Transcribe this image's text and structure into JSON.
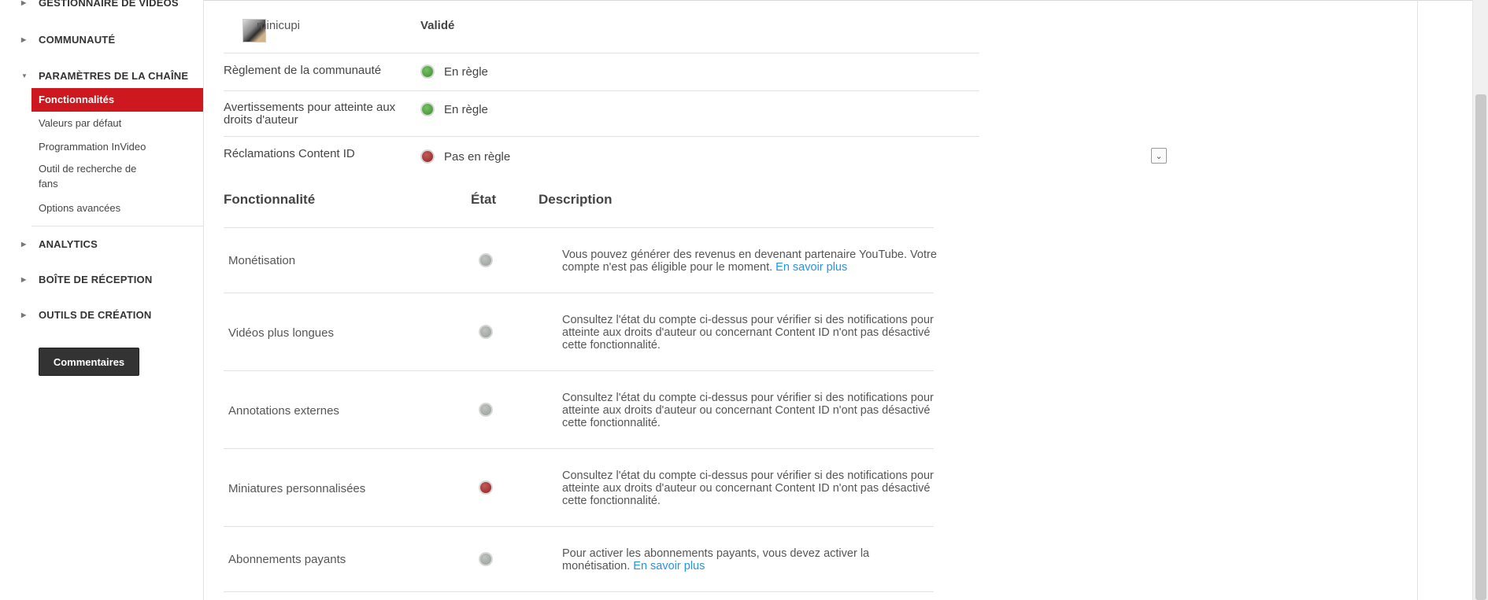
{
  "sidebar": {
    "sections": [
      {
        "label": "GESTIONNAIRE DE VIDÉOS"
      },
      {
        "label": "COMMUNAUTÉ"
      },
      {
        "label": "PARAMÈTRES DE LA CHAÎNE"
      },
      {
        "label": "ANALYTICS"
      },
      {
        "label": "BOÎTE DE RÉCEPTION"
      },
      {
        "label": "OUTILS DE CRÉATION"
      }
    ],
    "sub_items": [
      {
        "label": "Fonctionnalités"
      },
      {
        "label": "Valeurs par défaut"
      },
      {
        "label": "Programmation InVideo"
      },
      {
        "label": "Outil de recherche de fans"
      },
      {
        "label": "Options avancées"
      }
    ],
    "feedback_button": "Commentaires"
  },
  "account": {
    "username": "minicupi",
    "status": "Validé",
    "rows": [
      {
        "label": "Règlement de la communauté",
        "value": "En règle",
        "status": "green"
      },
      {
        "label": "Avertissements pour atteinte aux droits d'auteur",
        "value": "En règle",
        "status": "green"
      },
      {
        "label": "Réclamations Content ID",
        "value": "Pas en règle",
        "status": "red"
      }
    ]
  },
  "features": {
    "headers": {
      "feature": "Fonctionnalité",
      "state": "État",
      "description": "Description"
    },
    "link_label": "En savoir plus",
    "rows": [
      {
        "name": "Monétisation",
        "status": "grey",
        "desc": "Vous pouvez générer des revenus en devenant partenaire YouTube. Votre compte n'est pas éligible pour le moment.",
        "link": "En savoir plus"
      },
      {
        "name": "Vidéos plus longues",
        "status": "grey",
        "desc": "Consultez l'état du compte ci-dessus pour vérifier si des notifications pour atteinte aux droits d'auteur ou concernant Content ID n'ont pas désactivé cette fonctionnalité."
      },
      {
        "name": "Annotations externes",
        "status": "grey",
        "desc": "Consultez l'état du compte ci-dessus pour vérifier si des notifications pour atteinte aux droits d'auteur ou concernant Content ID n'ont pas désactivé cette fonctionnalité."
      },
      {
        "name": "Miniatures personnalisées",
        "status": "red",
        "desc": "Consultez l'état du compte ci-dessus pour vérifier si des notifications pour atteinte aux droits d'auteur ou concernant Content ID n'ont pas désactivé cette fonctionnalité."
      },
      {
        "name": "Abonnements payants",
        "status": "grey",
        "desc": "Pour activer les abonnements payants, vous devez activer la monétisation.",
        "link": "En savoir plus"
      }
    ]
  },
  "colors": {
    "active_nav": "#cc181e",
    "link": "#2793e6",
    "dark_button": "#333333"
  }
}
